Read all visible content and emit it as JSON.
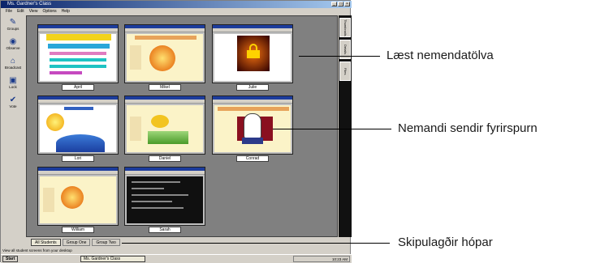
{
  "window": {
    "title": "Ms. Gardner's Class"
  },
  "menu": [
    "File",
    "Edit",
    "View",
    "Options",
    "Help"
  ],
  "toolbar": [
    {
      "label": "Groups",
      "icon": "groups-icon"
    },
    {
      "label": "Observe",
      "icon": "observe-icon"
    },
    {
      "label": "Broadcast",
      "icon": "broadcast-icon"
    },
    {
      "label": "Lock",
      "icon": "lock-icon"
    },
    {
      "label": "Vote",
      "icon": "vote-icon"
    }
  ],
  "students": [
    {
      "name": "April",
      "screen": "web"
    },
    {
      "name": "Mikel",
      "screen": "sun"
    },
    {
      "name": "Julie",
      "screen": "locked"
    },
    {
      "name": "Lori",
      "screen": "sun-planet"
    },
    {
      "name": "Daniel",
      "screen": "garden"
    },
    {
      "name": "Conrad",
      "screen": "hand-raised"
    },
    {
      "name": "William",
      "screen": "sun"
    },
    {
      "name": "Sarah",
      "screen": "dark"
    }
  ],
  "side_tabs": [
    "Thumbnails",
    "Details",
    "Files"
  ],
  "group_tabs": [
    "All Students",
    "Group One",
    "Group Two"
  ],
  "status": "View all student screens from your desktop",
  "taskbar": {
    "start": "Start",
    "task": "Ms. Gardner's Class",
    "clock": "10:23 AM"
  },
  "callouts": {
    "locked": "Læst nemendatölva",
    "request": "Nemandi sendir fyrirspurn",
    "groups": "Skipulagðir hópar"
  }
}
